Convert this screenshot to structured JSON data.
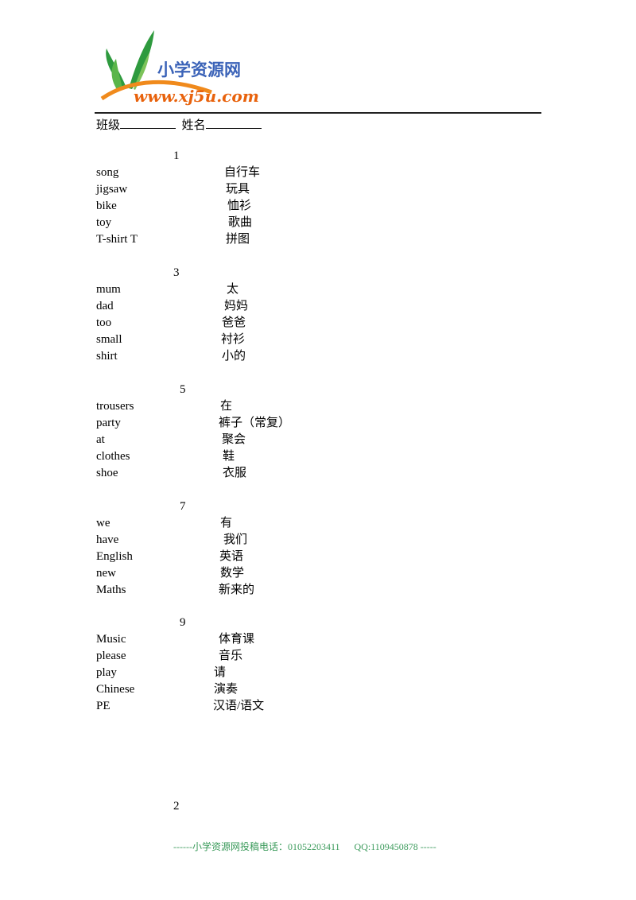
{
  "logo": {
    "cn_text": "小学资源网",
    "url_text": "www.xj5u.com",
    "colors": {
      "cn": "#3b63b8",
      "url": "#e8620c",
      "leaf": "#2e9a3e",
      "arc": "#f08a1c"
    }
  },
  "header": {
    "class_label": "班级",
    "name_label": "姓名"
  },
  "sections": [
    {
      "number": "1",
      "rows": [
        {
          "en": "song",
          "cn": "自行车"
        },
        {
          "en": "jigsaw",
          "cn": "玩具"
        },
        {
          "en": "bike",
          "cn": "恤衫"
        },
        {
          "en": "toy",
          "cn": "歌曲"
        },
        {
          "en": "T-shirt T",
          "cn": "拼图"
        }
      ]
    },
    {
      "number": "3",
      "rows": [
        {
          "en": "mum",
          "cn": "太"
        },
        {
          "en": "dad",
          "cn": "妈妈"
        },
        {
          "en": "too",
          "cn": "爸爸"
        },
        {
          "en": "small",
          "cn": "衬衫"
        },
        {
          "en": "shirt",
          "cn": "小的"
        }
      ]
    },
    {
      "number": "5",
      "rows": [
        {
          "en": "trousers",
          "cn": "在"
        },
        {
          "en": "party",
          "cn": "裤子（常复）"
        },
        {
          "en": "at",
          "cn": "聚会"
        },
        {
          "en": "clothes",
          "cn": "鞋"
        },
        {
          "en": "shoe",
          "cn": "衣服"
        }
      ]
    },
    {
      "number": "7",
      "rows": [
        {
          "en": "we",
          "cn": "有"
        },
        {
          "en": "have",
          "cn": "我们"
        },
        {
          "en": "English",
          "cn": "英语"
        },
        {
          "en": "new",
          "cn": "数学"
        },
        {
          "en": "Maths",
          "cn": "新来的"
        }
      ]
    },
    {
      "number": "9",
      "rows": [
        {
          "en": "Music",
          "cn": "体育课"
        },
        {
          "en": "please",
          "cn": "音乐"
        },
        {
          "en": "play",
          "cn": "请"
        },
        {
          "en": "Chinese",
          "cn": "演奏"
        },
        {
          "en": "PE",
          "cn": "汉语/语文"
        }
      ]
    }
  ],
  "page_number": "2",
  "footer": "------小学资源网投稿电话：01052203411      QQ:1109450878 -----"
}
